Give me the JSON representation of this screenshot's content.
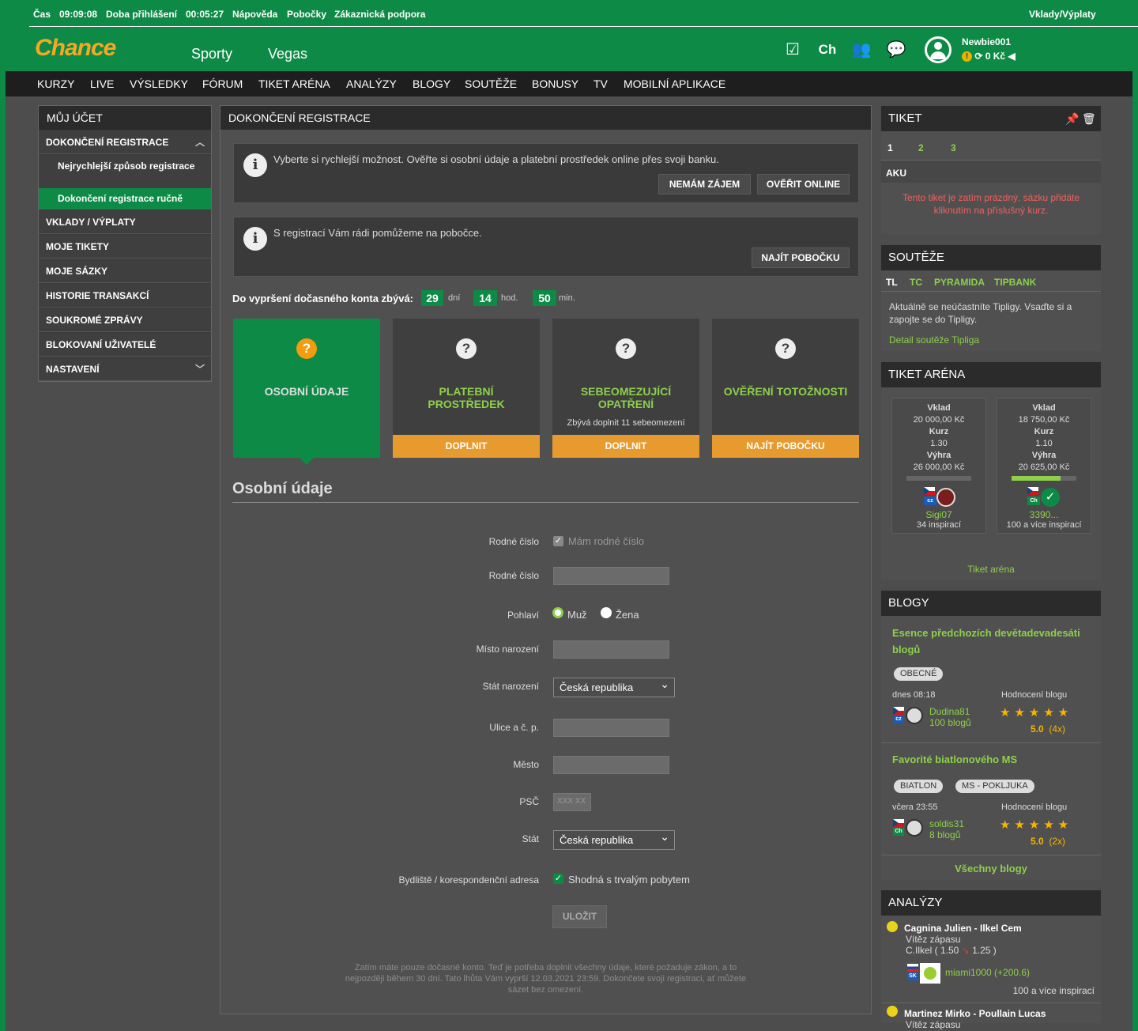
{
  "topbar": {
    "time_label": "Čas",
    "time": "09:09:08",
    "login_label": "Doba přihlášení",
    "login_time": "00:05:27",
    "help": "Nápověda",
    "branches": "Pobočky",
    "support": "Zákaznická podpora",
    "deposits": "Vklady/Výplaty"
  },
  "header": {
    "logo": "Chance",
    "sports": "Sporty",
    "vegas": "Vegas",
    "ch": "Ch",
    "username": "Newbie001",
    "balance": "0 Kč"
  },
  "mainnav": [
    "KURZY",
    "LIVE",
    "VÝSLEDKY",
    "FÓRUM",
    "TIKET ARÉNA",
    "ANALÝZY",
    "BLOGY",
    "SOUTĚŽE",
    "BONUSY",
    "TV",
    "MOBILNÍ APLIKACE"
  ],
  "leftmenu": {
    "title": "MŮJ ÚČET",
    "section": "DOKONČENÍ REGISTRACE",
    "sub1": "Nejrychlejší způsob registrace",
    "sub2": "Dokončení registrace ručně",
    "items": [
      "VKLADY / VÝPLATY",
      "MOJE TIKETY",
      "MOJE SÁZKY",
      "HISTORIE TRANSAKCÍ",
      "SOUKROMÉ ZPRÁVY",
      "BLOKOVANÍ UŽIVATELÉ",
      "NASTAVENÍ"
    ]
  },
  "main": {
    "title": "DOKONČENÍ REGISTRACE",
    "info1": "Vyberte si rychlejší možnost. Ověřte si osobní údaje a platební prostředek online přes svoji banku.",
    "btn_no": "NEMÁM ZÁJEM",
    "btn_verify": "OVĚŘIT ONLINE",
    "info2": "S registrací Vám rádi pomůžeme na pobočce.",
    "btn_branch": "NAJÍT POBOČKU",
    "countdown_label": "Do vypršení dočasného konta zbývá:",
    "days": "29",
    "days_unit": "dní",
    "hours": "14",
    "hours_unit": "hod.",
    "mins": "50",
    "mins_unit": "min.",
    "steps": [
      {
        "title": "OSOBNÍ ÚDAJE",
        "sub": "",
        "button": ""
      },
      {
        "title": "PLATEBNÍ PROSTŘEDEK",
        "sub": "",
        "button": "DOPLNIT"
      },
      {
        "title": "SEBEOMEZUJÍCÍ OPATŘENÍ",
        "sub": "Zbývá doplnit 11 sebeomezení",
        "button": "DOPLNIT"
      },
      {
        "title": "OVĚŘENÍ TOTOŽNOSTI",
        "sub": "",
        "button": "NAJÍT POBOČKU"
      }
    ],
    "form_title": "Osobní údaje",
    "labels": {
      "rc1": "Rodné číslo",
      "rc_check": "Mám rodné číslo",
      "rc2": "Rodné číslo",
      "gender": "Pohlaví",
      "male": "Muž",
      "female": "Žena",
      "birthplace": "Místo narození",
      "birthcountry": "Stát narození",
      "street": "Ulice a č. p.",
      "city": "Město",
      "zip": "PSČ",
      "zip_ph": "XXX XX",
      "country": "Stát",
      "addr": "Bydliště / korespondenční adresa",
      "same": "Shodná s trvalým pobytem"
    },
    "birthcountry_value": "Česká republika",
    "country_value": "Česká republika",
    "save": "ULOŽIT",
    "note": "Zatím máte pouze dočasné konto. Teď je potřeba doplnit všechny údaje, které požaduje zákon, a to nejpozději během 30 dní. Tato lhůta Vám vyprší 12.03.2021 23:59. Dokončete svoji registraci, ať můžete sázet bez omezení."
  },
  "tiket": {
    "title": "TIKET",
    "tabs": [
      "1",
      "2",
      "3"
    ],
    "aku": "AKU",
    "empty": "Tento tiket je zatím prázdný, sázku přidáte kliknutím na příslušný kurz."
  },
  "souteze": {
    "title": "SOUTĚŽE",
    "tabs": [
      "TL",
      "TC",
      "PYRAMIDA",
      "TIPBANK"
    ],
    "text": "Aktuálně se neúčastníte Tipligy. Vsaďte si a zapojte se do Tipligy.",
    "link": "Detail soutěže Tipliga"
  },
  "arena": {
    "title": "TIKET ARÉNA",
    "cards": [
      {
        "vklad_l": "Vklad",
        "vklad": "20 000,00 Kč",
        "kurz_l": "Kurz",
        "kurz": "1.30",
        "vyhra_l": "Výhra",
        "vyhra": "26 000,00 Kč",
        "user": "Sigi07",
        "insp": "34 inspirací",
        "cc": "cz",
        "progress": 0
      },
      {
        "vklad_l": "Vklad",
        "vklad": "18 750,00 Kč",
        "kurz_l": "Kurz",
        "kurz": "1.10",
        "vyhra_l": "Výhra",
        "vyhra": "20 625,00 Kč",
        "user": "3390...",
        "insp": "100 a více inspirací",
        "cc": "Ch",
        "progress": 0.75
      }
    ],
    "link": "Tiket aréna"
  },
  "blogy": {
    "title": "BLOGY",
    "posts": [
      {
        "title": "Esence předchozích devětadevadesáti blogů",
        "tags": [
          "OBECNÉ"
        ],
        "date": "dnes 08:18",
        "rating_label": "Hodnocení blogu",
        "user": "Dudina81",
        "count": "100 blogů",
        "score": "5.0",
        "votes": "(4x)",
        "cc": "cz"
      },
      {
        "title": "Favorité biatlonového MS",
        "tags": [
          "BIATLON",
          "MS - POKLJUKA"
        ],
        "date": "včera 23:55",
        "rating_label": "Hodnocení blogu",
        "user": "soldis31",
        "count": "8 blogů",
        "score": "5.0",
        "votes": "(2x)",
        "cc": "Ch"
      }
    ],
    "all": "Všechny blogy"
  },
  "analyzy": {
    "title": "ANALÝZY",
    "a1_match": "Cagnina Julien - Ilkel Cem",
    "a1_type": "Vítěz zápasu",
    "a1_pick": "C.Ilkel ( 1.50",
    "a1_odds": "1.25 )",
    "a1_user": "miami1000 (+200.6)",
    "a1_cc": "SK",
    "a1_insp": "100 a více inspirací",
    "a2_match": "Martinez Mirko - Poullain Lucas",
    "a2_type": "Vítěz zápasu"
  }
}
